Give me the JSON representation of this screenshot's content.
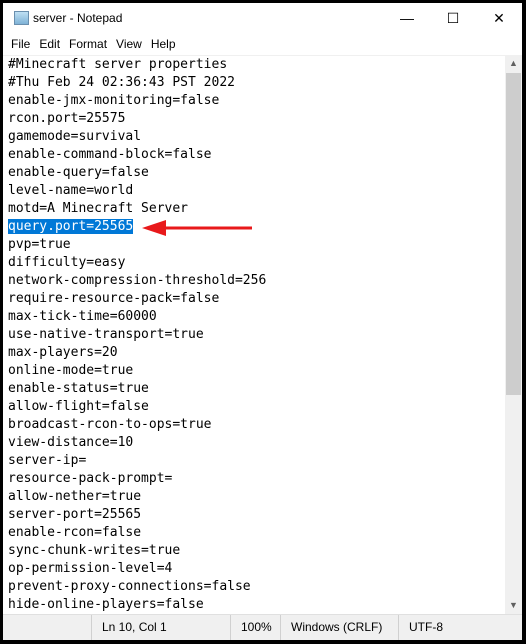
{
  "window": {
    "title": "server - Notepad",
    "minimize": "—",
    "maximize": "☐",
    "close": "✕"
  },
  "menu": [
    "File",
    "Edit",
    "Format",
    "View",
    "Help"
  ],
  "lines": [
    "#Minecraft server properties",
    "#Thu Feb 24 02:36:43 PST 2022",
    "enable-jmx-monitoring=false",
    "rcon.port=25575",
    "gamemode=survival",
    "enable-command-block=false",
    "enable-query=false",
    "level-name=world",
    "motd=A Minecraft Server",
    "query.port=25565",
    "pvp=true",
    "difficulty=easy",
    "network-compression-threshold=256",
    "require-resource-pack=false",
    "max-tick-time=60000",
    "use-native-transport=true",
    "max-players=20",
    "online-mode=true",
    "enable-status=true",
    "allow-flight=false",
    "broadcast-rcon-to-ops=true",
    "view-distance=10",
    "server-ip=",
    "resource-pack-prompt=",
    "allow-nether=true",
    "server-port=25565",
    "enable-rcon=false",
    "sync-chunk-writes=true",
    "op-permission-level=4",
    "prevent-proxy-connections=false",
    "hide-online-players=false"
  ],
  "selected_line": 9,
  "status": {
    "position": "Ln 10, Col 1",
    "zoom": "100%",
    "line_ending": "Windows (CRLF)",
    "encoding": "UTF-8"
  },
  "colors": {
    "selection": "#0078d7",
    "annotation_arrow": "#e8191b"
  }
}
